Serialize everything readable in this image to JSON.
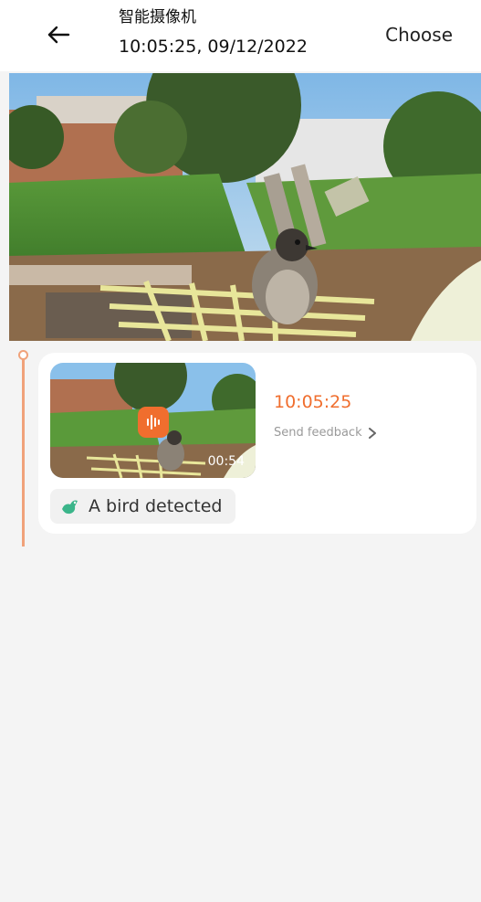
{
  "header": {
    "camera_name": "智能摄像机",
    "timestamp": "10:05:25, 09/12/2022",
    "choose_label": "Choose",
    "back_icon": "arrow-left-icon"
  },
  "player": {
    "scene": "camera-snapshot-bird-on-chair"
  },
  "events": [
    {
      "time": "10:05:25",
      "duration": "00:54",
      "feedback_label": "Send feedback",
      "detection_label": "A bird detected",
      "audio_icon": "audio-wave-icon",
      "detection_icon": "bird-icon"
    }
  ],
  "colors": {
    "accent": "#f06e2e",
    "timeline": "#f0a27a",
    "detection_icon": "#3bb58a"
  }
}
